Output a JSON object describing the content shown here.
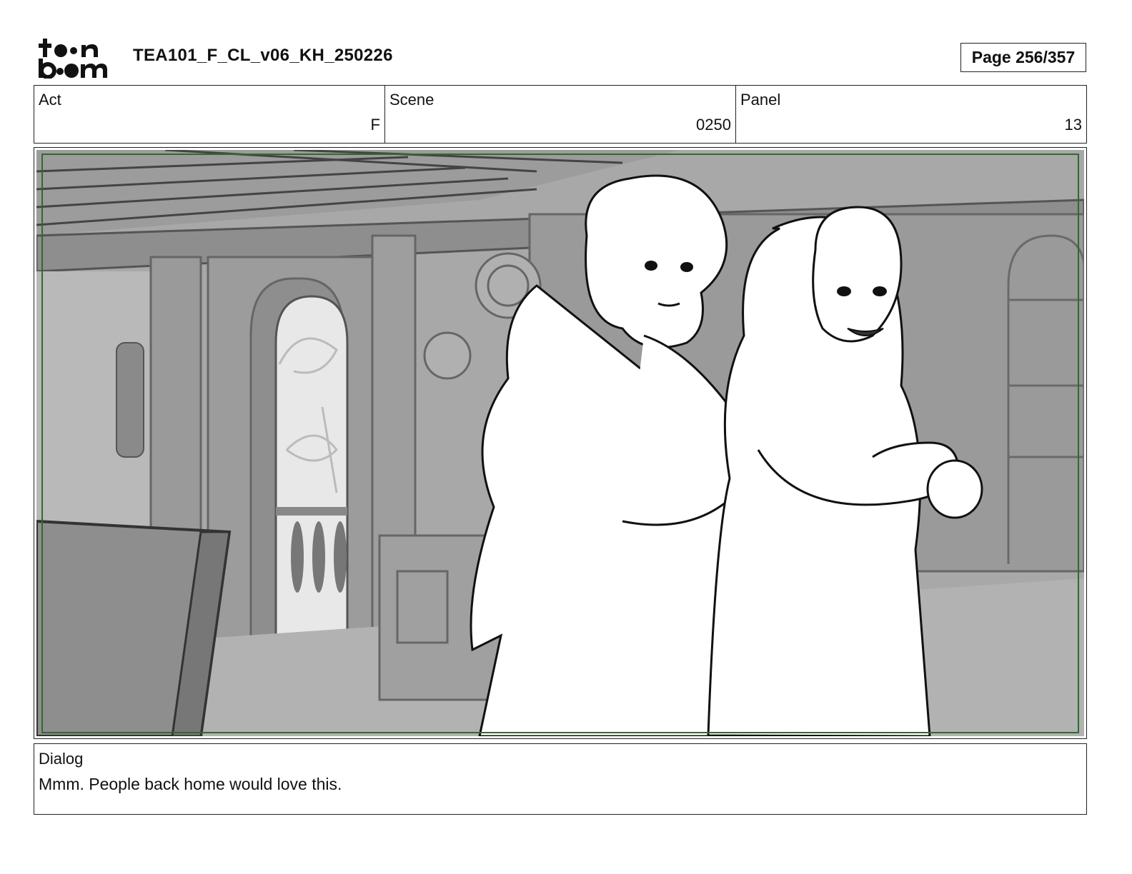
{
  "header": {
    "logo_text": "toonboom",
    "document_title": "TEA101_F_CL_v06_KH_250226",
    "page_label": "Page 256/357"
  },
  "info": {
    "act": {
      "label": "Act",
      "value": "F"
    },
    "scene": {
      "label": "Scene",
      "value": "0250"
    },
    "panel": {
      "label": "Panel",
      "value": "13"
    }
  },
  "artwork": {
    "icon": "storyboard-panel-drawing",
    "safe_frame_color": "#2e6b2e",
    "background_color": "#9a9a9a"
  },
  "dialog": {
    "label": "Dialog",
    "text": "Mmm. People back home would love this."
  }
}
